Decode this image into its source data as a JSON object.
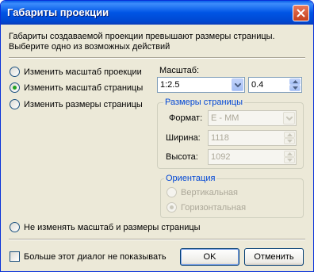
{
  "window": {
    "title": "Габариты проекции"
  },
  "description": {
    "line1": "Габариты создаваемой проекции превышают размеры страницы.",
    "line2": "Выберите одно из возможных действий"
  },
  "options": {
    "change_projection_scale": "Изменить масштаб проекции",
    "change_page_scale": "Изменить масштаб страницы",
    "change_page_size": "Изменить размеры страницы",
    "no_change": "Не изменять масштаб и размеры страницы",
    "selected": "change_page_scale"
  },
  "scale": {
    "label": "Масштаб:",
    "ratio_value": "1:2.5",
    "numeric_value": "0.4"
  },
  "page_size": {
    "group_title": "Размеры страницы",
    "format_label": "Формат:",
    "format_value": "E - MM",
    "width_label": "Ширина:",
    "width_value": "1118",
    "height_label": "Высота:",
    "height_value": "1092"
  },
  "orientation": {
    "group_title": "Ориентация",
    "portrait": "Вертикальная",
    "landscape": "Горизонтальная",
    "selected": "landscape"
  },
  "footer": {
    "dont_show_label": "Больше этот диалог не показывать",
    "ok_label": "OK",
    "cancel_label": "Отменить"
  },
  "icons": {
    "close": "close-icon",
    "dropdown": "chevron-down-icon",
    "spin_up": "spin-up-icon",
    "spin_down": "spin-down-icon"
  },
  "colors": {
    "title_bar": "#0055e5",
    "close_button": "#d6532f",
    "group_title": "#0046d5",
    "dialog_bg": "#ece9d8"
  }
}
